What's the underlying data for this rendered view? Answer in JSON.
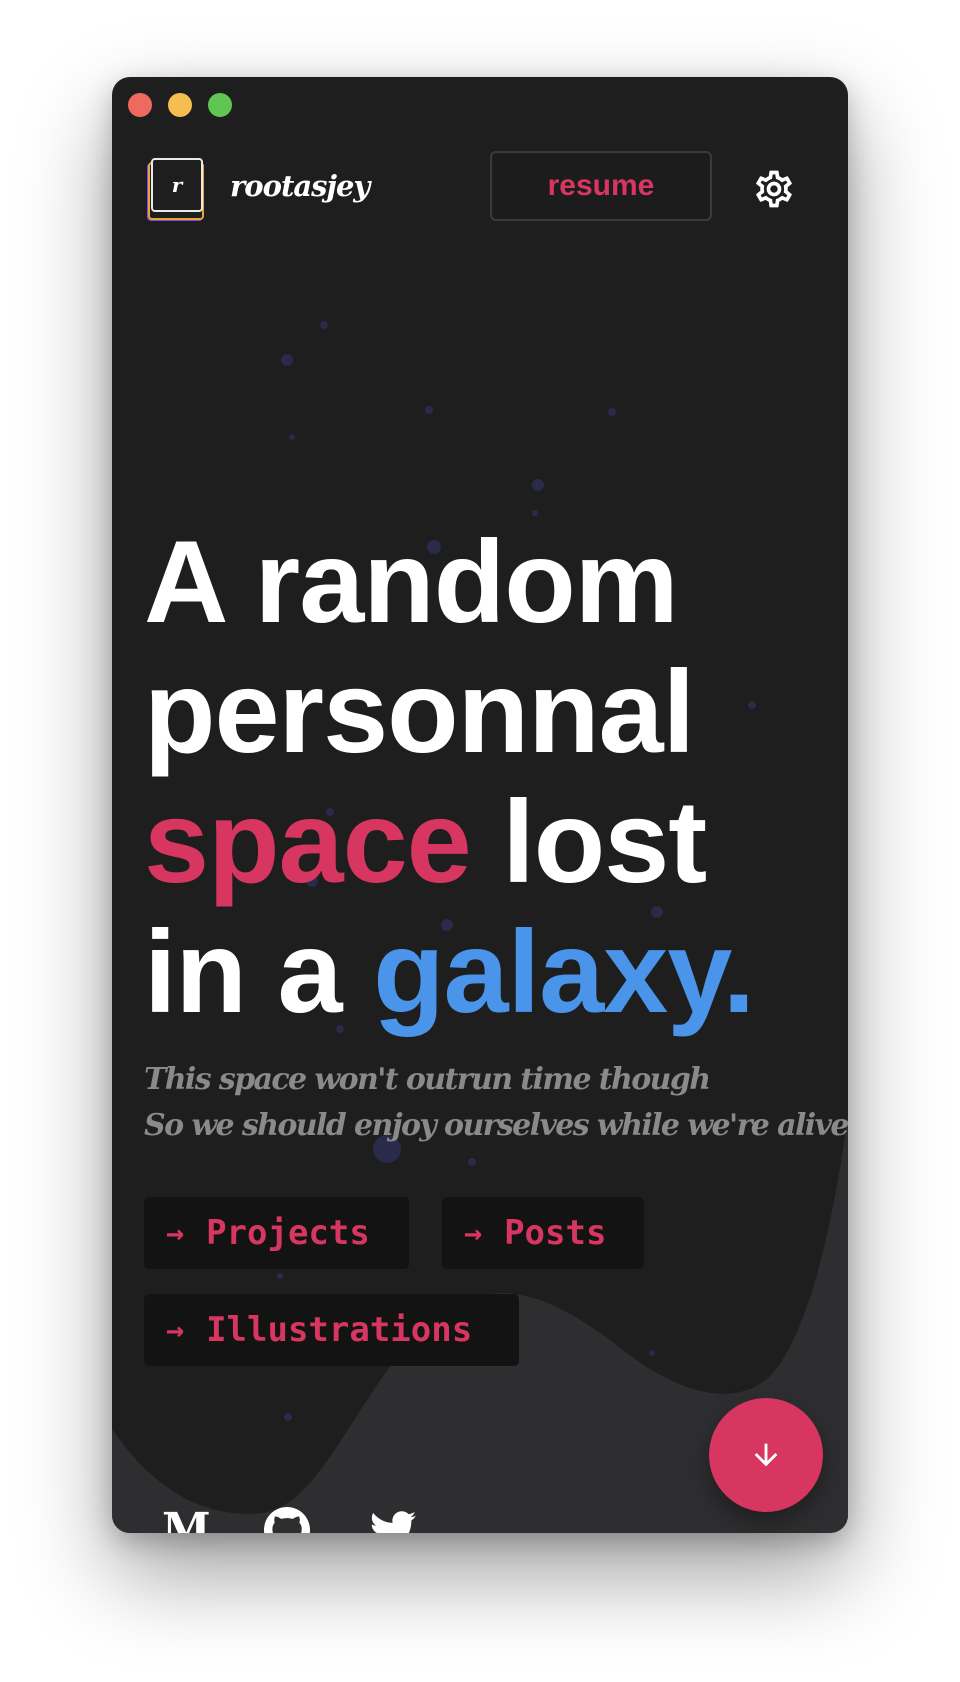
{
  "header": {
    "logo_letter": "r",
    "brand": "rootasjey",
    "resume_label": "resume"
  },
  "hero": {
    "line1": "A random",
    "line2": "personnal",
    "line3_accent": "space",
    "line3_rest": " lost",
    "line4_start": "in a ",
    "line4_accent": "galaxy."
  },
  "tagline": {
    "line1": "This space won't outrun time though",
    "line2": "So we should enjoy ourselves while we're alive"
  },
  "nav": {
    "projects": "Projects",
    "posts": "Posts",
    "illustrations": "Illustrations",
    "arrow": "→"
  },
  "social": {
    "medium_letter": "M"
  },
  "icons": {
    "settings": "gear-icon",
    "medium": "medium-icon",
    "github": "github-icon",
    "twitter": "twitter-icon",
    "scroll_down": "arrow-down-icon"
  },
  "colors": {
    "background": "#1e1e1f",
    "pink_accent": "#d6365f",
    "blue_accent": "#4a95ea",
    "muted_text": "#8a8a8b"
  }
}
